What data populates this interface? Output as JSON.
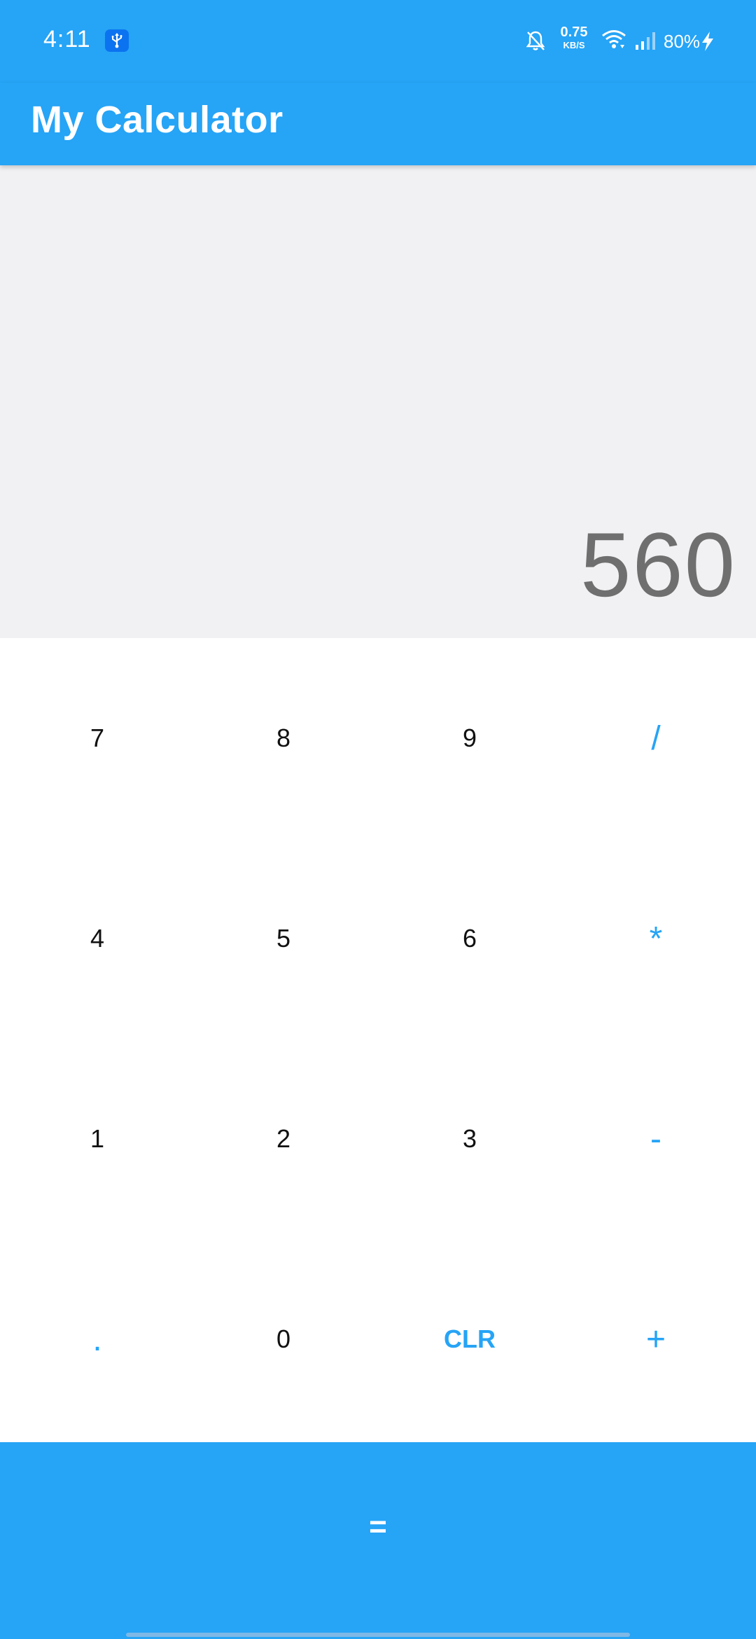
{
  "status_bar": {
    "time": "4:11",
    "net_speed_value": "0.75",
    "net_speed_unit": "KB/S",
    "battery": "80%",
    "icons": [
      "usb-icon",
      "bell-off-icon",
      "wifi-icon",
      "signal-icon",
      "charging-bolt-icon"
    ]
  },
  "app_bar": {
    "title": "My Calculator"
  },
  "display": {
    "value": "560"
  },
  "keypad": {
    "rows": [
      [
        "7",
        "8",
        "9",
        "/"
      ],
      [
        "4",
        "5",
        "6",
        "*"
      ],
      [
        "1",
        "2",
        "3",
        "-"
      ],
      [
        ".",
        "0",
        "CLR",
        "+"
      ]
    ],
    "equals": "="
  },
  "colors": {
    "primary": "#26a4f6",
    "display_bg": "#f1f1f3",
    "display_text": "#6f6f6f",
    "digit_text": "#111111",
    "operator_text": "#26a4f6"
  }
}
